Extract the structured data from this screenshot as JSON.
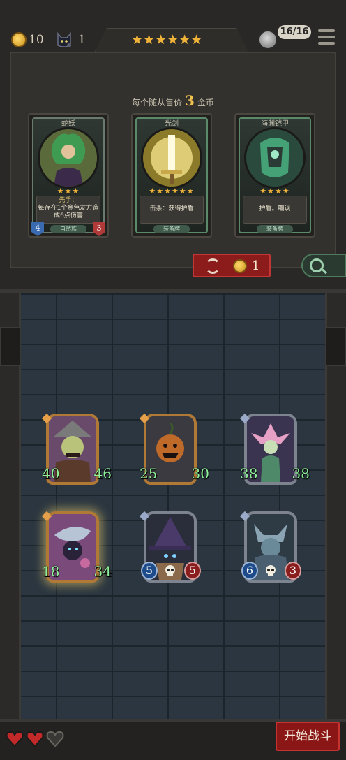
{
  "hud": {
    "gold": "10",
    "cat_count": "1",
    "stars": "★★★★★★",
    "hp_text": "16/16"
  },
  "shop": {
    "sell_prefix": "每个随从售价",
    "sell_price": "3",
    "sell_suffix": "金币",
    "refresh_cost": "1",
    "cards": [
      {
        "name": "蛇妖",
        "stars": "★★★",
        "desc_keyword": "先手：",
        "desc": "每存在1个金色友方造成6点伤害",
        "type": "自然族",
        "attack": "4",
        "health": "3"
      },
      {
        "name": "光剑",
        "stars": "★★★★★★",
        "desc": "击杀：获得护盾",
        "type": "装备牌"
      },
      {
        "name": "海渊铠甲",
        "stars": "★★★★",
        "desc": "护盾。嘲讽",
        "type": "装备牌"
      }
    ]
  },
  "board": {
    "minions": [
      {
        "attack": "40",
        "health": "46"
      },
      {
        "attack": "25",
        "health": "30"
      },
      {
        "attack": "38",
        "health": "38"
      },
      {
        "attack": "18",
        "health": "34"
      },
      {
        "attack": "5",
        "health": "5"
      },
      {
        "attack": "6",
        "health": "3"
      }
    ]
  },
  "footer": {
    "start_label": "开始战斗"
  },
  "colors": {
    "gold": "#f0b33a",
    "stat_green": "#8ff19a",
    "start_red": "#8a1616"
  }
}
